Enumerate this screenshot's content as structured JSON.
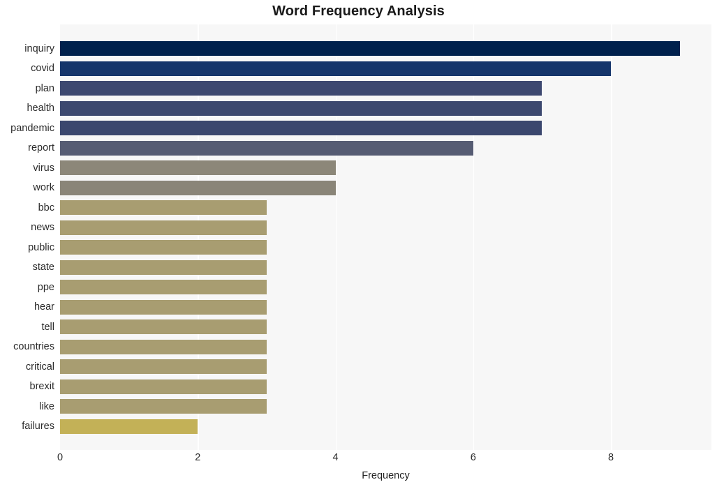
{
  "chart_data": {
    "type": "bar",
    "orientation": "horizontal",
    "title": "Word Frequency Analysis",
    "xlabel": "Frequency",
    "ylabel": "",
    "xlim": [
      0,
      9.46
    ],
    "ylim_categories_order": "descending-by-value",
    "grid": true,
    "grid_axis": "x",
    "legend": null,
    "xticks": [
      0,
      2,
      4,
      6,
      8
    ],
    "xtick_labels": [
      "0",
      "2",
      "4",
      "6",
      "8"
    ],
    "categories": [
      "inquiry",
      "covid",
      "plan",
      "health",
      "pandemic",
      "report",
      "virus",
      "work",
      "bbc",
      "news",
      "public",
      "state",
      "ppe",
      "hear",
      "tell",
      "countries",
      "critical",
      "brexit",
      "like",
      "failures"
    ],
    "values": [
      9,
      8,
      7,
      7,
      7,
      6,
      4,
      4,
      3,
      3,
      3,
      3,
      3,
      3,
      3,
      3,
      3,
      3,
      3,
      2
    ],
    "bar_colors": [
      "#00214d",
      "#15356b",
      "#3d4870",
      "#3c486f",
      "#3b476e",
      "#565c73",
      "#8c8779",
      "#8a8578",
      "#a89d71",
      "#a89d71",
      "#a89d71",
      "#a89d71",
      "#a89d71",
      "#a89d71",
      "#a89d71",
      "#a89d71",
      "#a89d71",
      "#a89d71",
      "#a89d71",
      "#c3b157"
    ],
    "plot_background": "#f7f7f7",
    "figure_background": "#ffffff",
    "gridline_color": "#ffffff"
  }
}
